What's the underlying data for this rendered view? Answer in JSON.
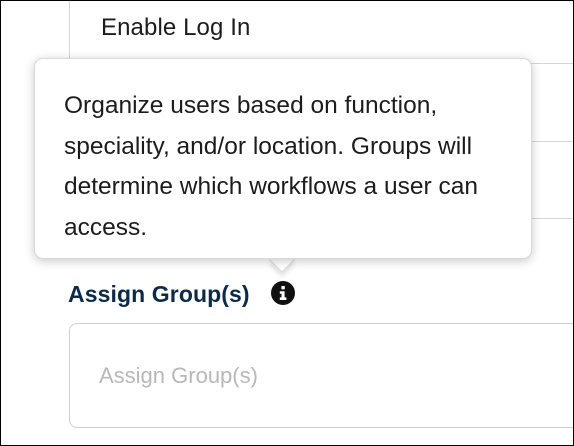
{
  "form": {
    "enable_login_label": "Enable Log In",
    "assign_group_label": "Assign Group(s)",
    "assign_group_placeholder": "Assign Group(s)",
    "assign_group_value": ""
  },
  "tooltip": {
    "text": "Organize users based on function, speciality, and/or location. Groups will determine which workflows a user can access."
  },
  "icons": {
    "info": "info-circle-icon"
  },
  "colors": {
    "label": "#0c2b4a",
    "text": "#1c1c1c",
    "placeholder": "#b8b8b8",
    "border": "#cfcfcf"
  }
}
